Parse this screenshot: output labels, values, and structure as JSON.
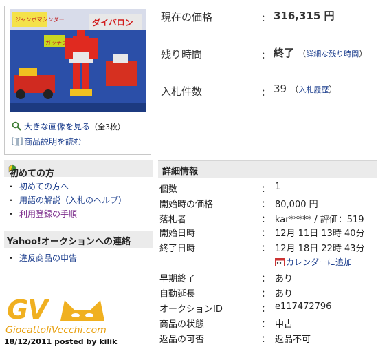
{
  "thumbnail": {
    "alt": "DAIBAROM toy box",
    "box_logo": "ダイバロン",
    "box_top": "ジャンボマシンダー",
    "box_callout": "ガッチン!"
  },
  "image_links": {
    "enlarge_label": "大きな画像を見る",
    "enlarge_count": "（全3枚）",
    "description_label": "商品説明を読む"
  },
  "price_block": {
    "current_price_label": "現在の価格",
    "current_price_colon": "：",
    "current_price_value": "316,315 円",
    "time_left_label": "残り時間",
    "time_left_colon": "：",
    "time_left_value": "終了",
    "time_left_link": "詳細な残り時間",
    "bids_label": "入札件数",
    "bids_colon": "：",
    "bids_value": "39",
    "bids_link": "入札履歴"
  },
  "beginners_box": {
    "title": "初めての方",
    "items": [
      "初めての方へ",
      "用語の解説（入札のヘルプ）",
      "利用登録の手順"
    ]
  },
  "contact_box": {
    "title": "Yahoo!オークションへの連絡",
    "items": [
      "違反商品の申告"
    ]
  },
  "details": {
    "title": "詳細情報",
    "rows": [
      {
        "label": "個数",
        "value": "1"
      },
      {
        "label": "開始時の価格",
        "value": "80,000 円"
      },
      {
        "label": "落札者",
        "value": "kar***** / 評価：519"
      },
      {
        "label": "開始日時",
        "value": "12月 11日 13時 40分"
      },
      {
        "label": "終了日時",
        "value": "12月 18日 22時 43分"
      },
      {
        "label": "",
        "value": "カレンダーに追加"
      },
      {
        "label": "早期終了",
        "value": "あり"
      },
      {
        "label": "自動延長",
        "value": "あり"
      },
      {
        "label": "オークションID",
        "value": "e117472796"
      },
      {
        "label": "商品の状態",
        "value": "中古"
      },
      {
        "label": "返品の可否",
        "value": "返品不可"
      }
    ],
    "colon": "："
  },
  "watermark": {
    "logo": "GV",
    "site": "GiocattoliVecchi.com",
    "posted": "18/12/2011 posted by kilik"
  },
  "colors": {
    "link": "#1a3c8c",
    "header_bg": "#ebebeb",
    "watermark": "#f0b020",
    "beginner_mark_green": "#3a9a2a",
    "beginner_mark_yellow": "#f2d21a"
  }
}
